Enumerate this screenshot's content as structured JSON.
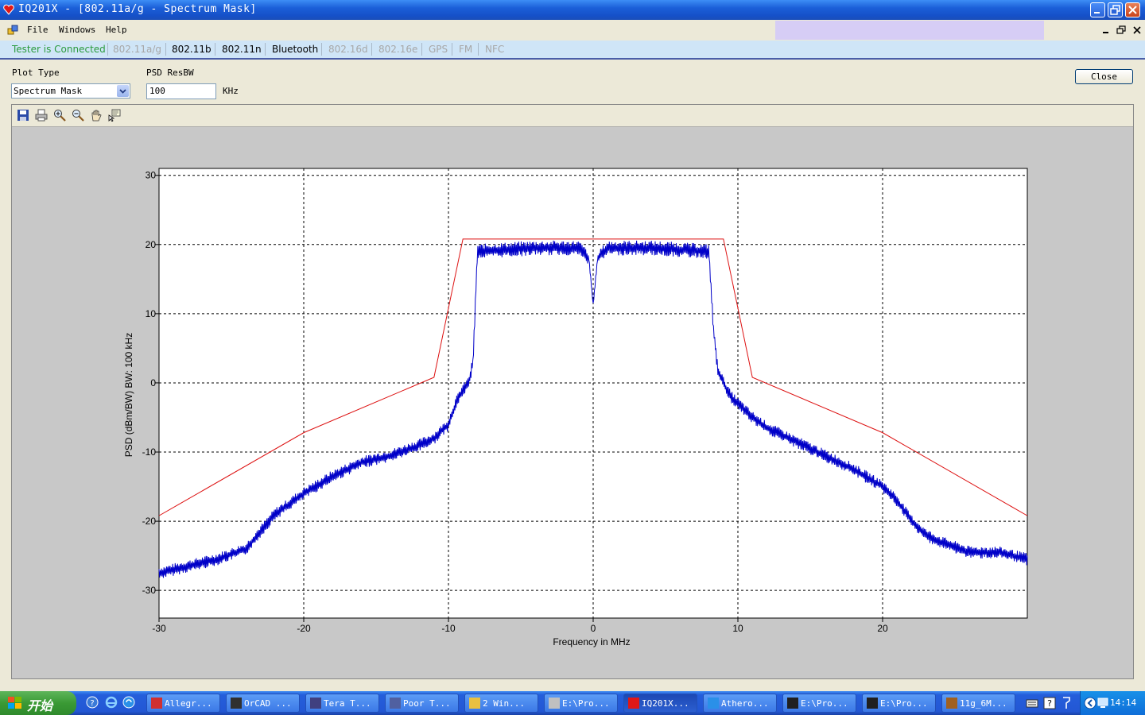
{
  "window": {
    "title": "IQ201X - [802.11a/g - Spectrum Mask]"
  },
  "menu": {
    "file": "File",
    "windows": "Windows",
    "help": "Help"
  },
  "tabs": {
    "status": "Tester is Connected",
    "items": [
      "802.11a/g",
      "802.11b",
      "802.11n",
      "Bluetooth",
      "802.16d",
      "802.16e",
      "GPS",
      "FM",
      "NFC"
    ]
  },
  "controls": {
    "plot_type_label": "Plot Type",
    "plot_type_value": "Spectrum Mask",
    "psd_resbw_label": "PSD ResBW",
    "psd_resbw_value": "100",
    "psd_resbw_unit": "KHz",
    "close_label": "Close"
  },
  "toolbar_icons": [
    "save-icon",
    "print-icon",
    "zoom-in-icon",
    "zoom-out-icon",
    "pan-hand-icon",
    "data-cursor-icon"
  ],
  "chart_data": {
    "type": "line",
    "xlabel": "Frequency in MHz",
    "ylabel": "PSD (dBm/BW) BW: 100 kHz",
    "xlim": [
      -30,
      30
    ],
    "ylim": [
      -34,
      31
    ],
    "xticks": [
      -30,
      -20,
      -10,
      0,
      10,
      20
    ],
    "yticks": [
      30,
      20,
      10,
      0,
      -10,
      -20,
      -30
    ],
    "grid": true,
    "colors": {
      "mask": "#dd1111",
      "spectrum": "#0000c8"
    },
    "series": [
      {
        "name": "",
        "role": "mask",
        "x": [
          -30,
          -20,
          -11,
          -9,
          9,
          11,
          20,
          30
        ],
        "y": [
          -19.2,
          -7.2,
          0.8,
          20.8,
          20.8,
          0.8,
          -7.2,
          -19.2
        ]
      },
      {
        "name": "",
        "role": "spectrum",
        "x": [
          -30,
          -28,
          -26,
          -24,
          -23,
          -22,
          -20,
          -18,
          -16,
          -14,
          -12,
          -11,
          -10,
          -9.5,
          -9,
          -8.6,
          -8.3,
          -8,
          -4,
          -1,
          -0.3,
          0,
          0.3,
          1,
          4,
          8,
          8.3,
          8.6,
          9,
          9.5,
          10,
          11,
          12,
          14,
          16,
          18,
          20,
          21,
          22,
          23,
          24,
          26,
          28,
          30
        ],
        "y": [
          -27.5,
          -26.5,
          -25.5,
          -24,
          -21.5,
          -19,
          -16,
          -13.5,
          -11.5,
          -10.5,
          -9,
          -8,
          -6,
          -3,
          -1,
          0,
          3,
          19,
          19.5,
          19.5,
          18,
          11.3,
          18,
          19.5,
          19.5,
          19,
          8,
          2,
          0,
          -2,
          -3,
          -5,
          -6.5,
          -8.5,
          -10.5,
          -12.5,
          -15,
          -17,
          -20,
          -22,
          -23,
          -24.5,
          -24.5,
          -25.5
        ]
      }
    ]
  },
  "taskbar": {
    "start_label": "开始",
    "tasks": [
      "Allegr...",
      "OrCAD ...",
      "Tera T...",
      "Poor T...",
      "2 Win...",
      "E:\\Pro...",
      "IQ201X...",
      "Athero...",
      "E:\\Pro...",
      "E:\\Pro...",
      "11g_6M..."
    ],
    "clock": "14:14"
  }
}
